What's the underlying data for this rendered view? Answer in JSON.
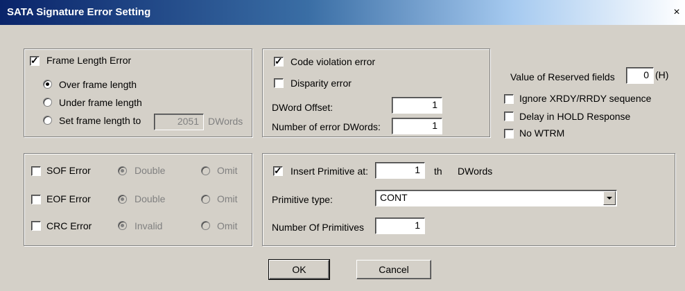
{
  "window": {
    "title": "SATA Signature Error Setting",
    "close_glyph": "×"
  },
  "frame_length": {
    "checkbox_label": "Frame Length Error",
    "checked": true,
    "options": [
      {
        "label": "Over frame length",
        "selected": true
      },
      {
        "label": "Under frame length",
        "selected": false
      },
      {
        "label": "Set frame length to",
        "selected": false
      }
    ],
    "length_value": "2051",
    "length_unit": "DWords"
  },
  "code_violation": {
    "code_violation_label": "Code violation error",
    "code_violation_checked": true,
    "disparity_label": "Disparity error",
    "disparity_checked": false,
    "dword_offset_label": "DWord Offset:",
    "dword_offset_value": "1",
    "num_error_label": "Number of error DWords:",
    "num_error_value": "1"
  },
  "reserved": {
    "label": "Value of Reserved fields",
    "value": "0",
    "unit": "(H)",
    "options": [
      {
        "label": "Ignore XRDY/RRDY sequence",
        "checked": false
      },
      {
        "label": "Delay  in HOLD Response",
        "checked": false
      },
      {
        "label": "No WTRM",
        "checked": false
      }
    ]
  },
  "sof_eof_crc": {
    "rows": [
      {
        "label": "SOF Error",
        "opt1": "Double",
        "opt2": "Omit"
      },
      {
        "label": "EOF Error",
        "opt1": "Double",
        "opt2": "Omit"
      },
      {
        "label": "CRC Error",
        "opt1": "Invalid",
        "opt2": "Omit"
      }
    ]
  },
  "primitive": {
    "insert_label": "Insert Primitive at:",
    "insert_checked": true,
    "insert_value": "1",
    "insert_suffix_th": "th",
    "insert_suffix_dwords": "DWords",
    "type_label": "Primitive type:",
    "type_value": "CONT",
    "count_label": "Number Of Primitives",
    "count_value": "1"
  },
  "buttons": {
    "ok": "OK",
    "cancel": "Cancel"
  }
}
